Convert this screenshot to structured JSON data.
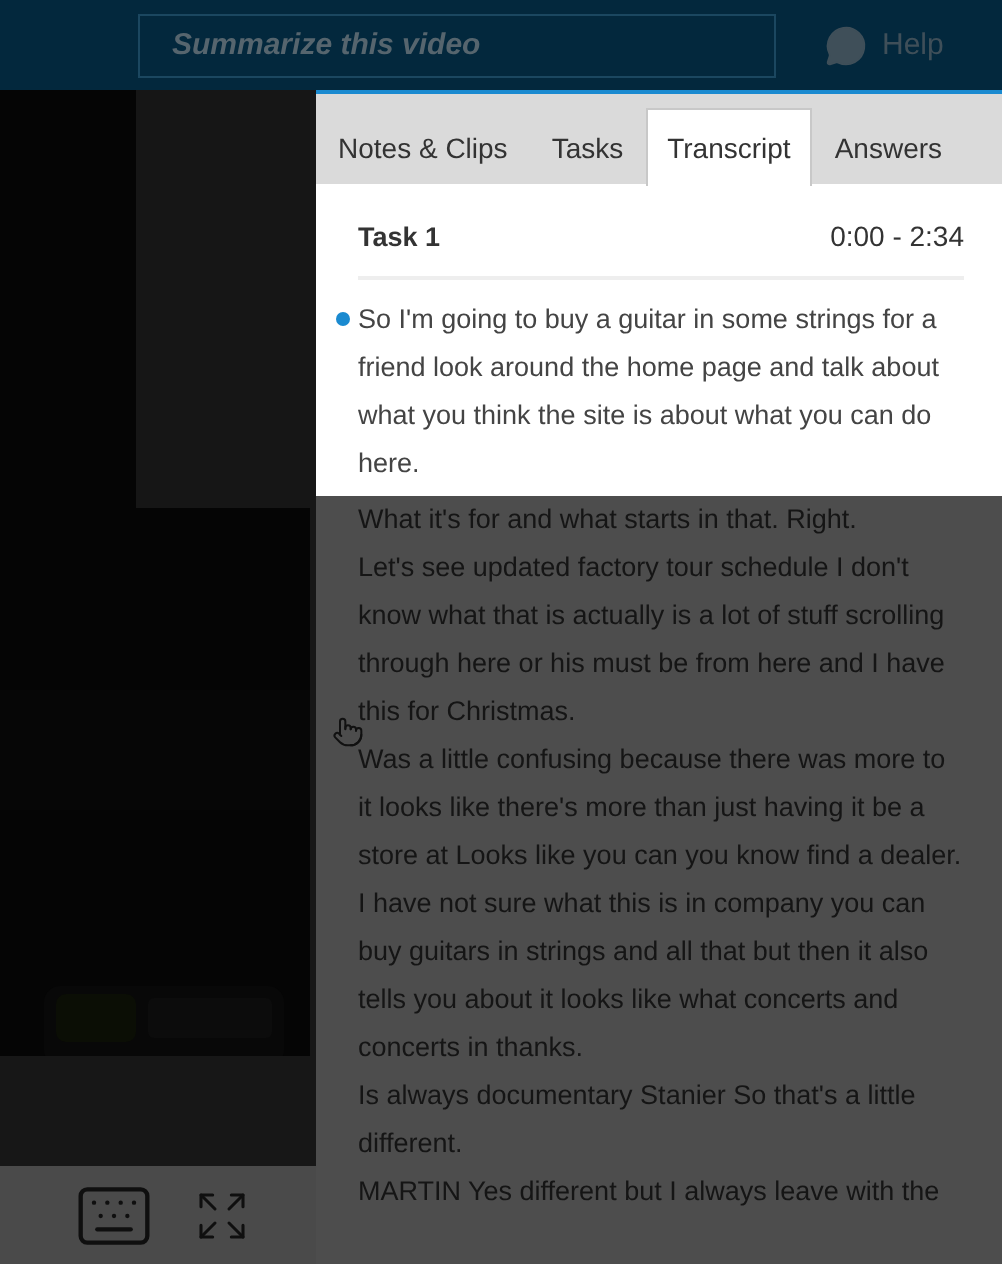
{
  "header": {
    "summary_field": {
      "placeholder": "Summarize this video"
    },
    "help": "Help"
  },
  "tabs": [
    {
      "label": "Notes & Clips",
      "selected": false
    },
    {
      "label": "Tasks",
      "selected": false
    },
    {
      "label": "Transcript",
      "selected": true
    },
    {
      "label": "Answers",
      "selected": false
    }
  ],
  "task": {
    "title": "Task 1",
    "time": "0:00 - 2:34"
  },
  "transcript": [
    {
      "text": "So I'm going to buy a guitar in some strings for a friend look around the home page and talk about what you think the site is about what you can do here.",
      "active": true
    },
    {
      "text": "What it's for and what starts in that. Right.",
      "active": false
    },
    {
      "text": "Let's see updated factory tour schedule I don't know what that is actually is a lot of stuff scrolling through here or his must be from here and I have this for Christmas.",
      "active": false
    },
    {
      "text": "Was a little confusing because there was more to it looks like there's more than just having it be a store at Looks like you can you know find a dealer.",
      "active": false
    },
    {
      "text": "I have not sure what this is in company you can buy guitars in strings and all that but then it also tells you about it looks like what concerts and concerts in thanks.",
      "active": false
    },
    {
      "text": "Is always documentary Stanier So that's a little different.",
      "active": false
    },
    {
      "text": "MARTIN Yes different but I always leave with the",
      "active": false
    }
  ]
}
